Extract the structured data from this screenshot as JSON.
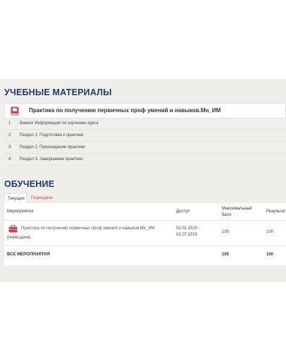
{
  "materials": {
    "heading": "УЧЕБНЫЕ МАТЕРИАЛЫ",
    "course_title": "Практика по получению первичных проф умений и навыков.Мн_ИМ",
    "sections": [
      {
        "num": "1",
        "label": "Важно! Информация по изучению курса"
      },
      {
        "num": "2",
        "label": "Раздел 1. Подготовка к практике"
      },
      {
        "num": "3",
        "label": "Раздел 2. Прохождение практики"
      },
      {
        "num": "4",
        "label": "Раздел 3. Завершение практики"
      }
    ]
  },
  "learning": {
    "heading": "ОБУЧЕНИЕ",
    "tabs": [
      "Текущие",
      "Пересдача"
    ],
    "columns": [
      "Мероприятие",
      "Доступ",
      "Максимальный балл",
      "Результат"
    ],
    "rows": [
      {
        "event": "Практика по получению первичных проф умений и навыков.Мн_ИМ",
        "event_suffix": "(пересдача)",
        "access_from": "02.01.2020 -",
        "access_to": "02.07.2020",
        "max_score": "100",
        "result": "100"
      }
    ],
    "totals": {
      "label": "ВСЕ МЕРОПРИЯТИЯ",
      "max_score": "100",
      "result": "100"
    }
  },
  "colors": {
    "heading": "#1f3a6e",
    "accent": "#c0475c",
    "panel": "#efeeea"
  }
}
